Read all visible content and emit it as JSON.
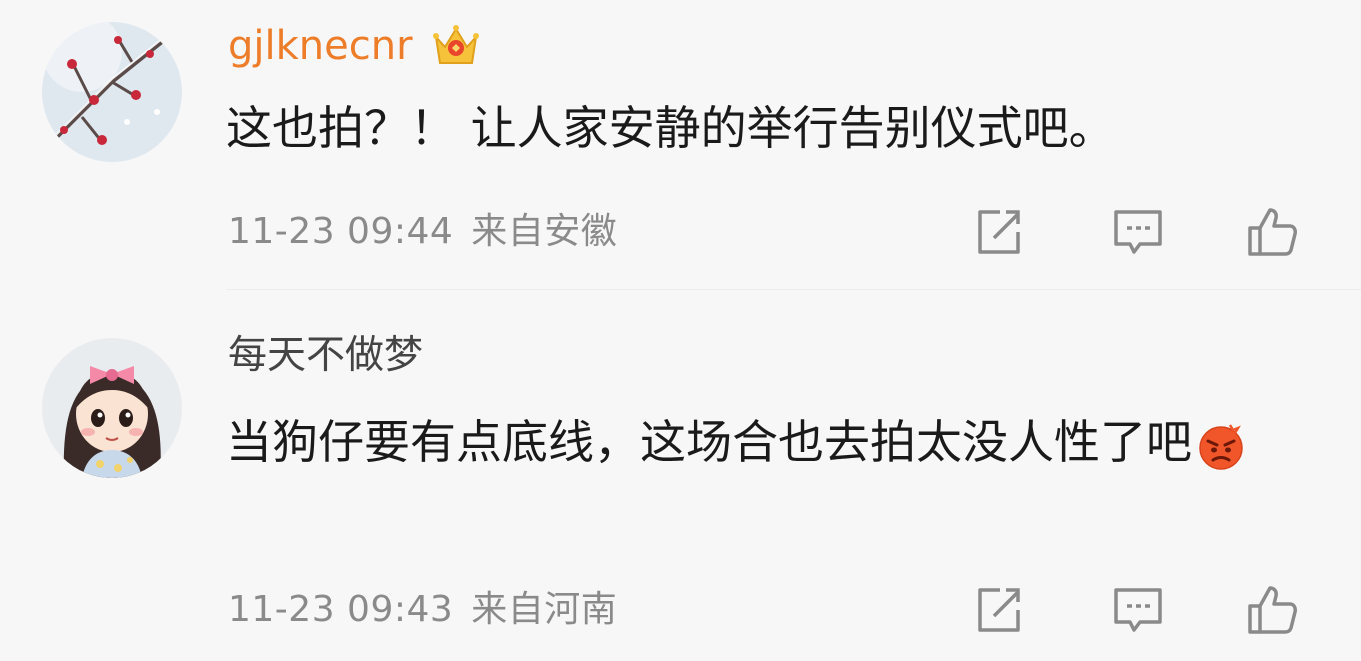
{
  "comments": [
    {
      "username": "gjlknecnr",
      "has_vip_badge": true,
      "avatar_icon": "snowy-plum-branch-avatar",
      "text": "这也拍？！ 让人家安静的举行告别仪式吧。",
      "timestamp": "11-23 09:44",
      "location": "来自安徽"
    },
    {
      "username": "每天不做梦",
      "has_vip_badge": false,
      "avatar_icon": "cartoon-girl-avatar",
      "text": "当狗仔要有点底线，这场合也去拍太没人性了吧",
      "emoji": "angry-face-emoji",
      "timestamp": "11-23 09:43",
      "location": "来自河南"
    }
  ],
  "colors": {
    "username_vip": "#ee7d2a",
    "username_normal": "#444444",
    "body_text": "#1a1a1a",
    "meta_text": "#8a8a8a",
    "icon_stroke": "#8a8a8a",
    "background": "#f7f7f8"
  }
}
